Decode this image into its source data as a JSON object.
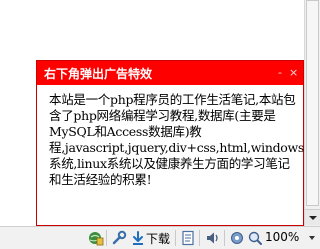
{
  "popup": {
    "title": "右下角弹出广告特效",
    "minimize_label": "-",
    "close_label": "×",
    "body_text": "本站是一个php程序员的工作生活笔记,本站包含了php网络编程学习教程,数据库(主要是MySQL和Access数据库)教程,javascript,jquery,div+css,html,windows系统,linux系统以及健康养生方面的学习笔记和生活经验的积累!"
  },
  "statusbar": {
    "download_label": "下载",
    "zoom_label": "100%",
    "icons": [
      "security-shield-icon",
      "tools-wrench-icon",
      "download-icon",
      "document-icon",
      "speaker-icon",
      "zoom-magnifier-icon"
    ]
  },
  "colors": {
    "popup_header": "#ff0000",
    "popup_border": "#cc0000",
    "statusbar_bg": "#f1f1f1"
  }
}
